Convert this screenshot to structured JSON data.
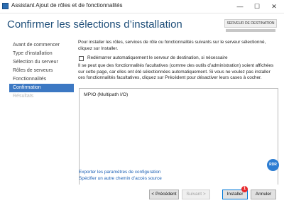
{
  "window": {
    "title": "Assistant Ajout de rôles et de fonctionnalités",
    "minimize_glyph": "—",
    "maximize_glyph": "☐",
    "close_glyph": "✕",
    "app_icon": "server-manager-icon"
  },
  "header": {
    "page_title": "Confirmer les sélections d’installation",
    "destination_label": "SERVEUR DE DESTINATION"
  },
  "sidebar": {
    "items": [
      {
        "label": "Avant de commencer",
        "state": "normal"
      },
      {
        "label": "Type d’installation",
        "state": "normal"
      },
      {
        "label": "Sélection du serveur",
        "state": "normal"
      },
      {
        "label": "Rôles de serveurs",
        "state": "normal"
      },
      {
        "label": "Fonctionnalités",
        "state": "normal"
      },
      {
        "label": "Confirmation",
        "state": "active"
      },
      {
        "label": "Résultats",
        "state": "disabled"
      }
    ]
  },
  "content": {
    "intro": "Pour installer les rôles, services de rôle ou fonctionnalités suivants sur le serveur sélectionné, cliquez sur Installer.",
    "restart_checkbox_label": "Redémarrer automatiquement le serveur de destination, si nécessaire",
    "restart_checked": false,
    "optional_note": "Il se peut que des fonctionnalités facultatives (comme des outils d’administration) soient affichées sur cette page, car elles ont été sélectionnées automatiquement. Si vous ne voulez pas installer ces fonctionnalités facultatives, cliquez sur Précédent pour désactiver leurs cases à cocher.",
    "features": [
      "MPIO (Multipath I/O)"
    ],
    "export_link": "Exporter les paramètres de configuration",
    "alt_source_link": "Spécifier un autre chemin d’accès source"
  },
  "overlay": {
    "badge_text": "RDR",
    "step_number": "1"
  },
  "footer": {
    "previous_label": "< Précédent",
    "next_label": "Suivant >",
    "install_label": "Installer",
    "cancel_label": "Annuler"
  },
  "colors": {
    "title_blue": "#1e4e79",
    "active_nav": "#3c78c3",
    "link": "#1a5fb4",
    "step_badge": "#e8282b"
  }
}
